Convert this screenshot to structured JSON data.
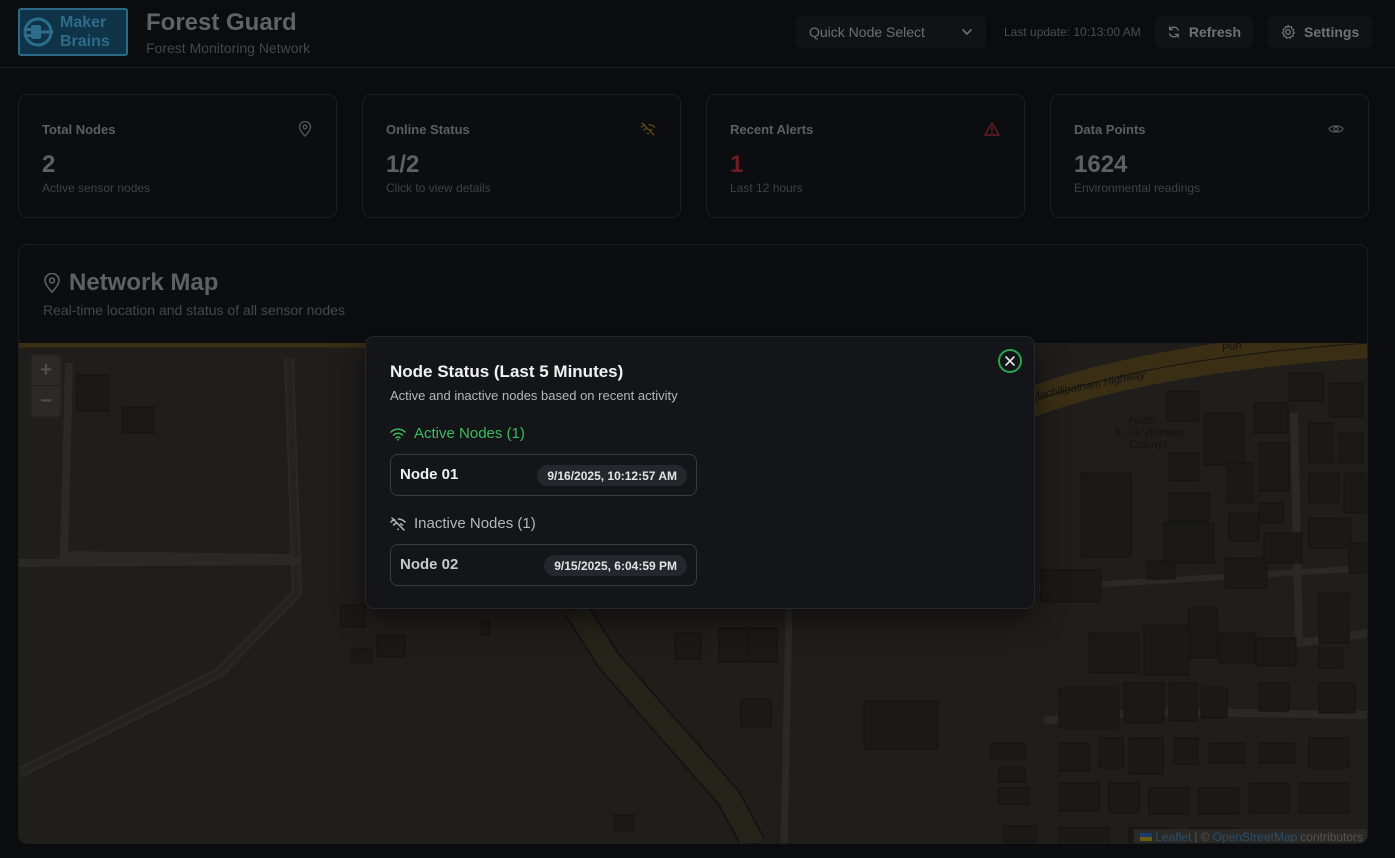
{
  "header": {
    "logo_line1": "Maker",
    "logo_line2": "Brains",
    "title": "Forest Guard",
    "subtitle": "Forest Monitoring Network",
    "quick_select_label": "Quick Node Select",
    "last_update": "Last update: 10:13:00 AM",
    "refresh_label": "Refresh",
    "settings_label": "Settings"
  },
  "stats": [
    {
      "title": "Total Nodes",
      "value": "2",
      "desc": "Active sensor nodes",
      "icon": "map-pin-icon"
    },
    {
      "title": "Online Status",
      "value": "1/2",
      "desc": "Click to view details",
      "icon": "wifi-off-icon"
    },
    {
      "title": "Recent Alerts",
      "value": "1",
      "desc": "Last 12 hours",
      "icon": "alert-triangle-icon"
    },
    {
      "title": "Data Points",
      "value": "1624",
      "desc": "Environmental readings",
      "icon": "eye-icon"
    }
  ],
  "map": {
    "title": "Network Map",
    "desc": "Real-time location and status of all sensor nodes",
    "zoom_in": "+",
    "zoom_out": "−",
    "street_highway": "Machilipatnam Highway",
    "street_road": "Pun",
    "place_label_1": "Hothi",
    "place_label_2": "K - IV (Fareed",
    "place_label_3": "Colony)",
    "attribution_leaflet": "Leaflet",
    "attribution_sep": "| ©",
    "attribution_osm": "OpenStreetMap",
    "attribution_suffix": "contributors"
  },
  "modal": {
    "title": "Node Status (Last 5 Minutes)",
    "desc": "Active and inactive nodes based on recent activity",
    "active_heading": "Active Nodes (1)",
    "inactive_heading": "Inactive Nodes (1)",
    "active_nodes": [
      {
        "name": "Node 01",
        "time": "9/16/2025, 10:12:57 AM"
      }
    ],
    "inactive_nodes": [
      {
        "name": "Node 02",
        "time": "9/15/2025, 6:04:59 PM"
      }
    ]
  },
  "colors": {
    "active_green": "#3dbb5c",
    "alert_red": "#6a1d22",
    "modal_bg": "#141518",
    "page_bg": "#0b0c0e"
  }
}
